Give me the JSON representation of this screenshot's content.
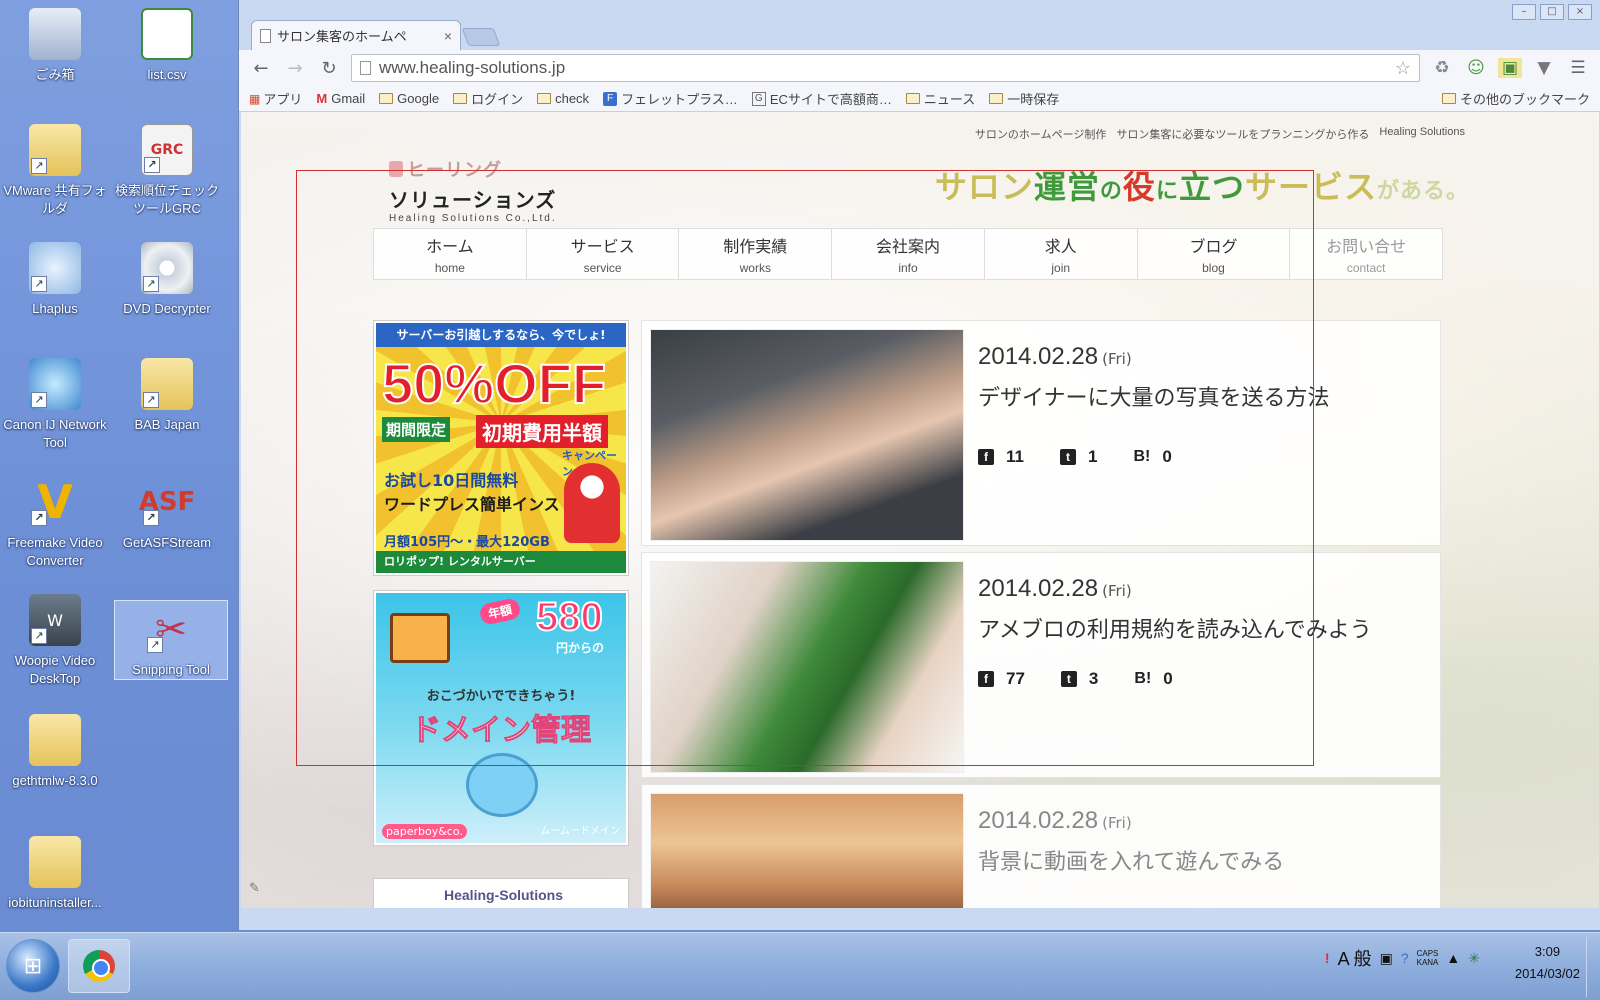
{
  "desktop": {
    "icons": [
      {
        "label": "ごみ箱",
        "icon": "recycle-bin-icon"
      },
      {
        "label": "list.csv",
        "icon": "csv-file-icon"
      },
      {
        "label": "VMware 共有フォルダ",
        "icon": "folder-icon"
      },
      {
        "label": "検索順位チェックツールGRC",
        "icon": "grc-app-icon",
        "glyph": "GRC"
      },
      {
        "label": "Lhaplus",
        "icon": "lhaplus-icon"
      },
      {
        "label": "DVD Decrypter",
        "icon": "dvd-icon"
      },
      {
        "label": "Canon IJ Network Tool",
        "icon": "canon-network-icon"
      },
      {
        "label": "BAB Japan",
        "icon": "folder-icon"
      },
      {
        "label": "Freemake Video Converter",
        "icon": "freemake-icon",
        "glyph": "V"
      },
      {
        "label": "GetASFStream",
        "icon": "asf-icon",
        "glyph": "ASF"
      },
      {
        "label": "Woopie Video DeskTop",
        "icon": "woopie-icon",
        "glyph": "W"
      },
      {
        "label": "Snipping Tool",
        "icon": "scissors-icon",
        "glyph": "✂"
      },
      {
        "label": "gethtmlw-8.3.0",
        "icon": "folder-icon"
      },
      {
        "label": "iobituninstaller...",
        "icon": "folder-icon"
      }
    ]
  },
  "browser": {
    "tab_title": "サロン集客のホームペ",
    "tab_close": "×",
    "url": "www.healing-solutions.jp",
    "window_controls": [
      "–",
      "□",
      "×"
    ],
    "nav": {
      "back": "←",
      "forward": "→",
      "reload": "↻",
      "star": "☆"
    },
    "extensions": [
      "♻",
      "☺",
      "▣",
      "▼",
      "☰"
    ],
    "bookmarks": [
      {
        "label": "アプリ",
        "type": "apps"
      },
      {
        "label": "Gmail",
        "type": "gmail"
      },
      {
        "label": "Google",
        "type": "folder"
      },
      {
        "label": "ログイン",
        "type": "folder"
      },
      {
        "label": "check",
        "type": "folder"
      },
      {
        "label": "フェレットプラス…",
        "type": "site"
      },
      {
        "label": "ECサイトで高額商…",
        "type": "site"
      },
      {
        "label": "ニュース",
        "type": "folder"
      },
      {
        "label": "一時保存",
        "type": "folder"
      }
    ],
    "other_bookmarks": "その他のブックマーク"
  },
  "site": {
    "tagline": [
      "サロンのホームページ制作",
      "サロン集客に必要なツールをプランニングから作る",
      "Healing Solutions"
    ],
    "logo": {
      "top": "ヒーリング",
      "mid": "ソリューションズ",
      "sub": "Healing Solutions Co.,Ltd."
    },
    "slogan": {
      "p1": "サロン",
      "p2": "運営",
      "p3": "の",
      "p4": "役",
      "p5": "に",
      "p6": "立つ",
      "p7": "サービス",
      "p8": "がある。"
    },
    "gnav": [
      {
        "jp": "ホーム",
        "en": "home"
      },
      {
        "jp": "サービス",
        "en": "service"
      },
      {
        "jp": "制作実績",
        "en": "works"
      },
      {
        "jp": "会社案内",
        "en": "info"
      },
      {
        "jp": "求人",
        "en": "join"
      },
      {
        "jp": "ブログ",
        "en": "blog"
      },
      {
        "jp": "お問い合せ",
        "en": "contact"
      }
    ],
    "ad1": {
      "top": "サーバーお引越しするなら、今でしょ!",
      "big": "50%OFF",
      "l1": "期間限定",
      "l1b": "初期費用半額",
      "l1c": "キャンペーン",
      "l2": "お試し10日間無料",
      "l3": "ワードプレス簡単インストール",
      "l4": "月額105円〜・最大120GB",
      "l5": "ロリポップ! レンタルサーバー"
    },
    "ad2": {
      "badge": "年額",
      "price": "580",
      "price_from": "円からの",
      "l1": "おこづかいでできちゃう!",
      "l2": "ドメイン管理",
      "l3": "paperboy&co.",
      "l4": "ムームードメイン"
    },
    "ad3": {
      "label": "Healing-Solutions"
    },
    "posts": [
      {
        "date": "2014.02.28",
        "day": "(Fri)",
        "title": "デザイナーに大量の写真を送る方法",
        "fb": "11",
        "tw": "1",
        "hb": "0"
      },
      {
        "date": "2014.02.28",
        "day": "(Fri)",
        "title": "アメブロの利用規約を読み込んでみよう",
        "fb": "77",
        "tw": "3",
        "hb": "0"
      },
      {
        "date": "2014.02.28",
        "day": "(Fri)",
        "title": "背景に動画を入れて遊んでみる"
      }
    ],
    "share_icons": {
      "fb": "f",
      "tw": "t",
      "hb": "B!"
    }
  },
  "taskbar": {
    "start": "⊞",
    "tray": {
      "flag": "!",
      "ime": "A 般",
      "caps": "CAPS",
      "kana": "KANA",
      "arrow": "▲",
      "net": "✳"
    },
    "time": "3:09",
    "date": "2014/03/02"
  },
  "colors": {
    "accent_red": "#d63a2a",
    "accent_green": "#3e9a3a",
    "desktop_blue": "#7f9fe0"
  }
}
